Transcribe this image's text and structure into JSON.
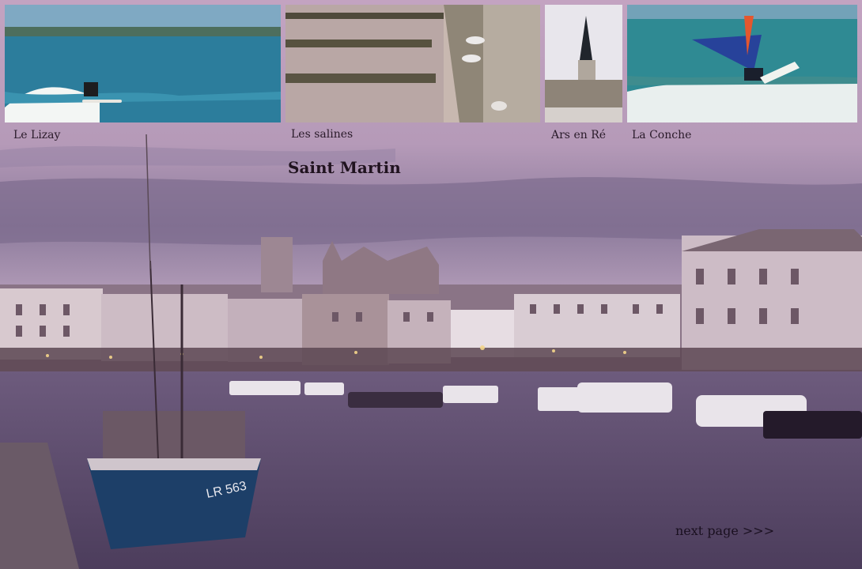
{
  "thumbnails": [
    {
      "caption": "Le Lizay"
    },
    {
      "caption": "Les salines"
    },
    {
      "caption": "Ars en Ré"
    },
    {
      "caption": "La Conche"
    }
  ],
  "title": "Saint Martin",
  "boat_registration": "LR 563",
  "next_link": "next page >>>",
  "colors": {
    "sky_top": "#c9a6c6",
    "sky_mid": "#8e7a9a",
    "water": "#5b4a6b",
    "sea_blue": "#2f7f99",
    "boat_hull": "#20456f"
  }
}
